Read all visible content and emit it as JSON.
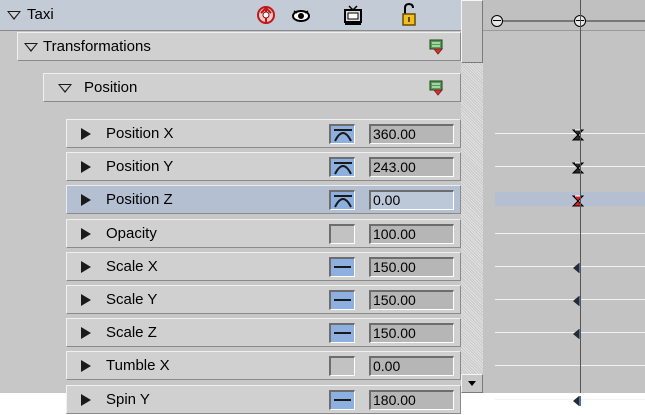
{
  "header": {
    "title": "Taxi",
    "icons": [
      "motion-path-icon",
      "eye-icon",
      "tv-display-icon",
      "padlock-unlocked-icon"
    ]
  },
  "groups": {
    "transformations_label": "Transformations",
    "position_label": "Position"
  },
  "params": [
    {
      "label": "Position X",
      "value": "360.00",
      "interpolation": "curve",
      "selected": false,
      "key": "hourglass",
      "key_color": "#2a2a2a"
    },
    {
      "label": "Position Y",
      "value": "243.00",
      "interpolation": "curve",
      "selected": false,
      "key": "hourglass",
      "key_color": "#2a2a2a"
    },
    {
      "label": "Position Z",
      "value": "0.00",
      "interpolation": "curve",
      "selected": true,
      "key": "hourglass",
      "key_color": "#e02020"
    },
    {
      "label": "Opacity",
      "value": "100.00",
      "interpolation": "none",
      "selected": false,
      "key": "none",
      "key_color": ""
    },
    {
      "label": "Scale X",
      "value": "150.00",
      "interpolation": "linear",
      "selected": false,
      "key": "half-left",
      "key_color": "#2a2a2a"
    },
    {
      "label": "Scale Y",
      "value": "150.00",
      "interpolation": "linear",
      "selected": false,
      "key": "half-left",
      "key_color": "#2a2a2a"
    },
    {
      "label": "Scale Z",
      "value": "150.00",
      "interpolation": "linear",
      "selected": false,
      "key": "half-left",
      "key_color": "#2a2a2a"
    },
    {
      "label": "Tumble X",
      "value": "0.00",
      "interpolation": "none",
      "selected": false,
      "key": "none",
      "key_color": ""
    },
    {
      "label": "Spin Y",
      "value": "180.00",
      "interpolation": "linear",
      "selected": false,
      "key": "half-left",
      "key_color": "#2a2a2a"
    }
  ],
  "colors": {
    "header_bg": "#c3cbd6",
    "selected_row": "#b4c0d2",
    "interp_button": "#8eb0e0",
    "key_selected": "#e02020"
  }
}
